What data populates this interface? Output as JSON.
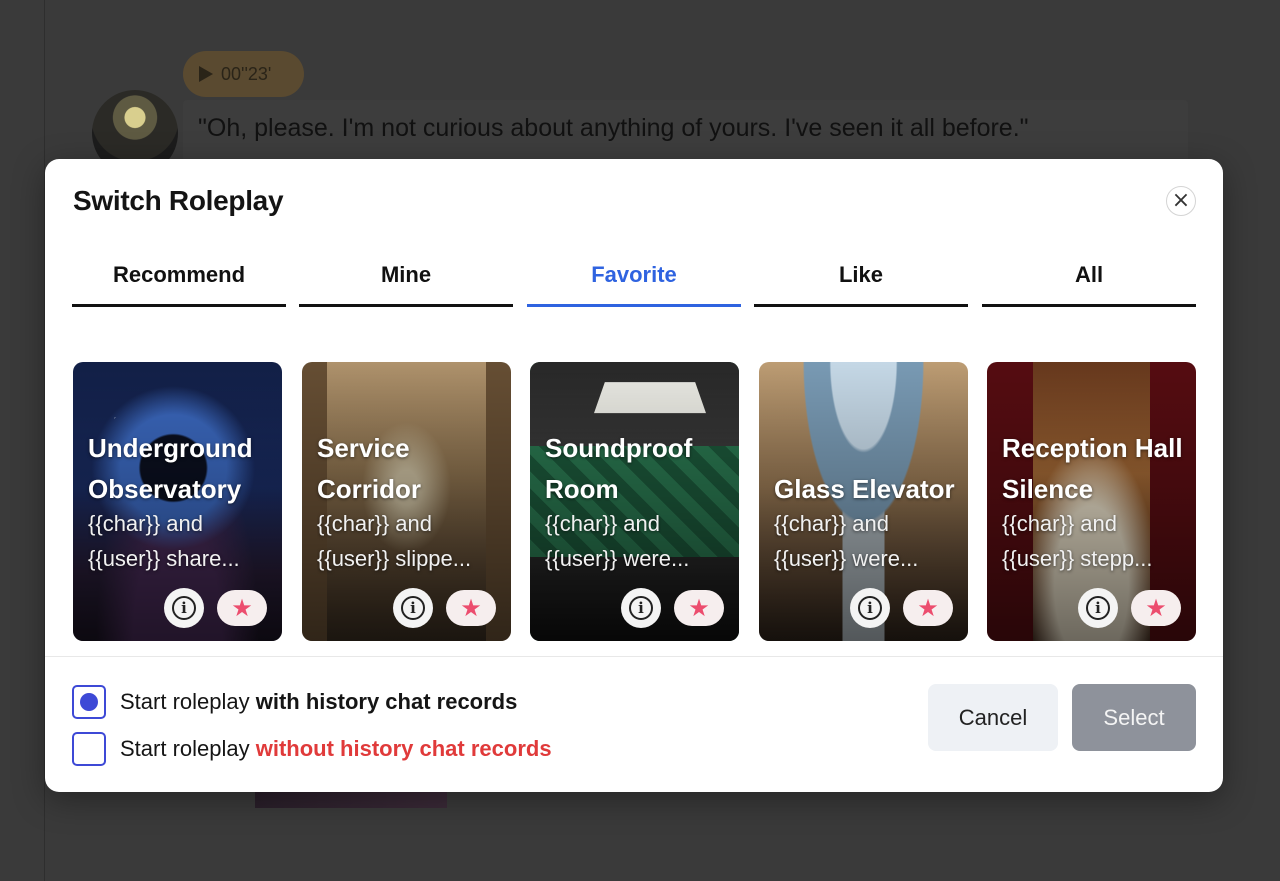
{
  "background": {
    "audio_duration": "00''23'",
    "message": "\"Oh, please. I'm not curious about anything of yours. I've seen it all before.\""
  },
  "modal": {
    "title": "Switch Roleplay",
    "close_icon": "×",
    "tabs": [
      {
        "label": "Recommend",
        "active": false
      },
      {
        "label": "Mine",
        "active": false
      },
      {
        "label": "Favorite",
        "active": true
      },
      {
        "label": "Like",
        "active": false
      },
      {
        "label": "All",
        "active": false
      }
    ],
    "cards": [
      {
        "title": "Underground Observatory",
        "desc_line1": "{{char}} and",
        "desc_line2": "{{user}} share..."
      },
      {
        "title": "Service Corridor",
        "desc_line1": "{{char}} and",
        "desc_line2": "{{user}} slippe..."
      },
      {
        "title": "Soundproof Room",
        "desc_line1": "{{char}} and",
        "desc_line2": "{{user}} were..."
      },
      {
        "title": "Glass Elevator",
        "desc_line1": "{{char}} and",
        "desc_line2": "{{user}} were..."
      },
      {
        "title": "Reception Hall Silence",
        "desc_line1": "{{char}} and",
        "desc_line2": "{{user}} stepp..."
      }
    ],
    "info_glyph": "i",
    "favorite_glyph": "★",
    "options": {
      "with_history": {
        "prefix": "Start roleplay ",
        "emphasis": "with history chat records",
        "checked": true
      },
      "without_history": {
        "prefix": "Start roleplay ",
        "emphasis": "without history chat records",
        "checked": false
      }
    },
    "buttons": {
      "cancel": "Cancel",
      "select": "Select"
    }
  },
  "colors": {
    "accent": "#2f63e0",
    "checkbox": "#3d49d6",
    "favorite": "#ec4d6e",
    "warning_text": "#e03a3a",
    "select_disabled": "#8e929b"
  }
}
